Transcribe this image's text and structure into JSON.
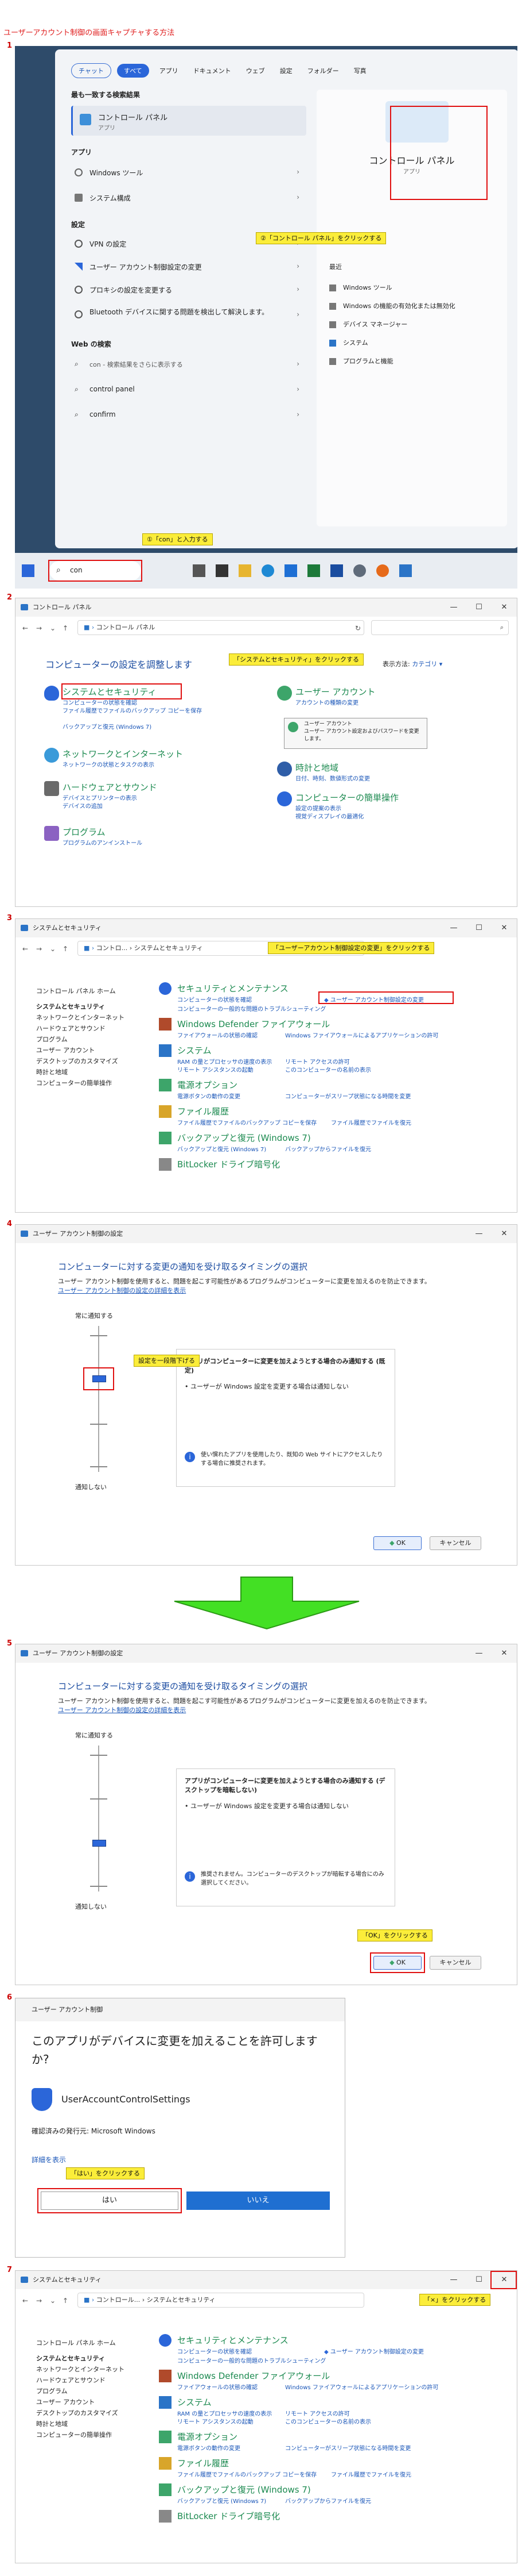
{
  "page_title": "ユーザーアカウント制御の画面キャプチャする方法",
  "steps": [
    {
      "num": "1"
    },
    {
      "num": "2"
    },
    {
      "num": "3"
    },
    {
      "num": "4"
    },
    {
      "num": "5"
    },
    {
      "num": "6"
    },
    {
      "num": "7"
    }
  ],
  "s1": {
    "tabs": [
      "チャット",
      "すべて",
      "アプリ",
      "ドキュメント",
      "ウェブ",
      "設定",
      "フォルダー",
      "写真"
    ],
    "best_header": "最も一致する検索結果",
    "best_item": "コントロール パネル",
    "best_sub": "アプリ",
    "apps_header": "アプリ",
    "apps": [
      "Windows ツール",
      "システム構成"
    ],
    "settings_header": "設定",
    "settings": [
      "VPN の設定",
      "ユーザー アカウント制御設定の変更",
      "プロキシの設定を変更する",
      "Bluetooth デバイスに関する問題を検出して解決します。"
    ],
    "web_header": "Web の検索",
    "web": [
      "con - 検索結果をさらに表示する",
      "control panel",
      "confirm"
    ],
    "preview_title": "コントロール パネル",
    "preview_sub": "アプリ",
    "recent_header": "最近",
    "recent": [
      "Windows ツール",
      "Windows の機能の有効化または無効化",
      "デバイス マネージャー",
      "システム",
      "プログラムと機能"
    ],
    "search_value": "con",
    "callout_click": "②「コントロール パネル」をクリックする",
    "callout_type": "①「con」と入力する"
  },
  "s2": {
    "title": "コントロール パネル",
    "breadcrumb": "コントロール パネル",
    "heading": "コンピューターの設定を調整します",
    "view_label": "表示方法:",
    "view_value": "カテゴリ ▾",
    "callout": "「システムとセキュリティ」をクリックする",
    "categories": [
      {
        "h": "システムとセキュリティ",
        "subs": [
          "コンピューターの状態を確認",
          "ファイル履歴でファイルのバックアップ コピーを保存",
          "バックアップと復元 (Windows 7)"
        ]
      },
      {
        "h": "ネットワークとインターネット",
        "subs": [
          "ネットワークの状態とタスクの表示"
        ]
      },
      {
        "h": "ハードウェアとサウンド",
        "subs": [
          "デバイスとプリンターの表示",
          "デバイスの追加"
        ]
      },
      {
        "h": "プログラム",
        "subs": [
          "プログラムのアンインストール"
        ]
      },
      {
        "h": "ユーザー アカウント",
        "subs": [
          "アカウントの種類の変更"
        ]
      },
      {
        "h": "時計と地域",
        "subs": [
          "日付、時刻、数値形式の変更"
        ]
      },
      {
        "h": "コンピューターの簡単操作",
        "subs": [
          "設定の提案の表示",
          "視覚ディスプレイの最適化"
        ]
      }
    ],
    "tooltip": [
      "ユーザー アカウント",
      "ユーザー アカウント設定およびパスワードを変更します。"
    ]
  },
  "s3": {
    "title": "システムとセキュリティ",
    "breadcrumb": "コントロ... › システムとセキュリティ",
    "callout": "「ユーザーアカウント制御設定の変更」をクリックする",
    "sidebar": [
      "コントロール パネル ホーム",
      "システムとセキュリティ",
      "ネットワークとインターネット",
      "ハードウェアとサウンド",
      "プログラム",
      "ユーザー アカウント",
      "デスクトップのカスタマイズ",
      "時計と地域",
      "コンピューターの簡単操作"
    ],
    "sections": [
      {
        "h": "セキュリティとメンテナンス",
        "lines": [
          "コンピューターの状態を確認",
          "ユーザー アカウント制御設定の変更",
          "コンピューターの一般的な問題のトラブルシューティング"
        ]
      },
      {
        "h": "Windows Defender ファイアウォール",
        "lines": [
          "ファイアウォールの状態の確認",
          "Windows ファイアウォールによるアプリケーションの許可"
        ]
      },
      {
        "h": "システム",
        "lines": [
          "RAM の量とプロセッサの速度の表示",
          "リモート アクセスの許可",
          "リモート アシスタンスの起動",
          "このコンピューターの名前の表示"
        ]
      },
      {
        "h": "電源オプション",
        "lines": [
          "電源ボタンの動作の変更",
          "コンピューターがスリープ状態になる時間を変更"
        ]
      },
      {
        "h": "ファイル履歴",
        "lines": [
          "ファイル履歴でファイルのバックアップ コピーを保存",
          "ファイル履歴でファイルを復元"
        ]
      },
      {
        "h": "バックアップと復元 (Windows 7)",
        "lines": [
          "バックアップと復元 (Windows 7)",
          "バックアップからファイルを復元"
        ]
      },
      {
        "h": "BitLocker ドライブ暗号化",
        "lines": []
      }
    ]
  },
  "s4": {
    "title": "ユーザー アカウント制御の設定",
    "heading": "コンピューターに対する変更の通知を受け取るタイミングの選択",
    "desc": "ユーザー アカウント制御を使用すると、問題を起こす可能性があるプログラムがコンピューターに変更を加えるのを防止できます。",
    "link": "ユーザー アカウント制御の設定の詳細を表示",
    "always": "常に通知する",
    "never": "通知しない",
    "box_title": "アプリがコンピューターに変更を加えようとする場合のみ通知する (既定)",
    "box_bullet": "ユーザーが Windows 設定を変更する場合は通知しない",
    "box_note": "使い慣れたアプリを使用したり、既知の Web サイトにアクセスしたりする場合に推奨されます。",
    "ok": "OK",
    "cancel": "キャンセル",
    "callout": "設定を一段階下げる"
  },
  "s5": {
    "title": "ユーザー アカウント制御の設定",
    "heading": "コンピューターに対する変更の通知を受け取るタイミングの選択",
    "desc": "ユーザー アカウント制御を使用すると、問題を起こす可能性があるプログラムがコンピューターに変更を加えるのを防止できます。",
    "link": "ユーザー アカウント制御の設定の詳細を表示",
    "always": "常に通知する",
    "never": "通知しない",
    "box_title": "アプリがコンピューターに変更を加えようとする場合のみ通知する (デスクトップを暗転しない)",
    "box_bullet1": "ユーザーが Windows 設定を変更する場合は通知しない",
    "box_note": "推奨されません。コンピューターのデスクトップが暗転する場合にのみ選択してください。",
    "ok": "OK",
    "cancel": "キャンセル",
    "callout": "「OK」をクリックする"
  },
  "s6": {
    "title": "ユーザー アカウント制御",
    "question": "このアプリがデバイスに変更を加えることを許可しますか?",
    "app": "UserAccountControlSettings",
    "publisher": "確認済みの発行元: Microsoft Windows",
    "details": "詳細を表示",
    "yes": "はい",
    "no": "いいえ",
    "callout": "「はい」をクリックする"
  },
  "s7": {
    "title": "システムとセキュリティ",
    "breadcrumb": "コントロール... › システムとセキュリティ",
    "callout": "「×」をクリックする"
  },
  "colors": {
    "red": "#e01010",
    "callout": "#fbed3a",
    "green_arrow": "#43e024",
    "link": "#1a56b8"
  }
}
